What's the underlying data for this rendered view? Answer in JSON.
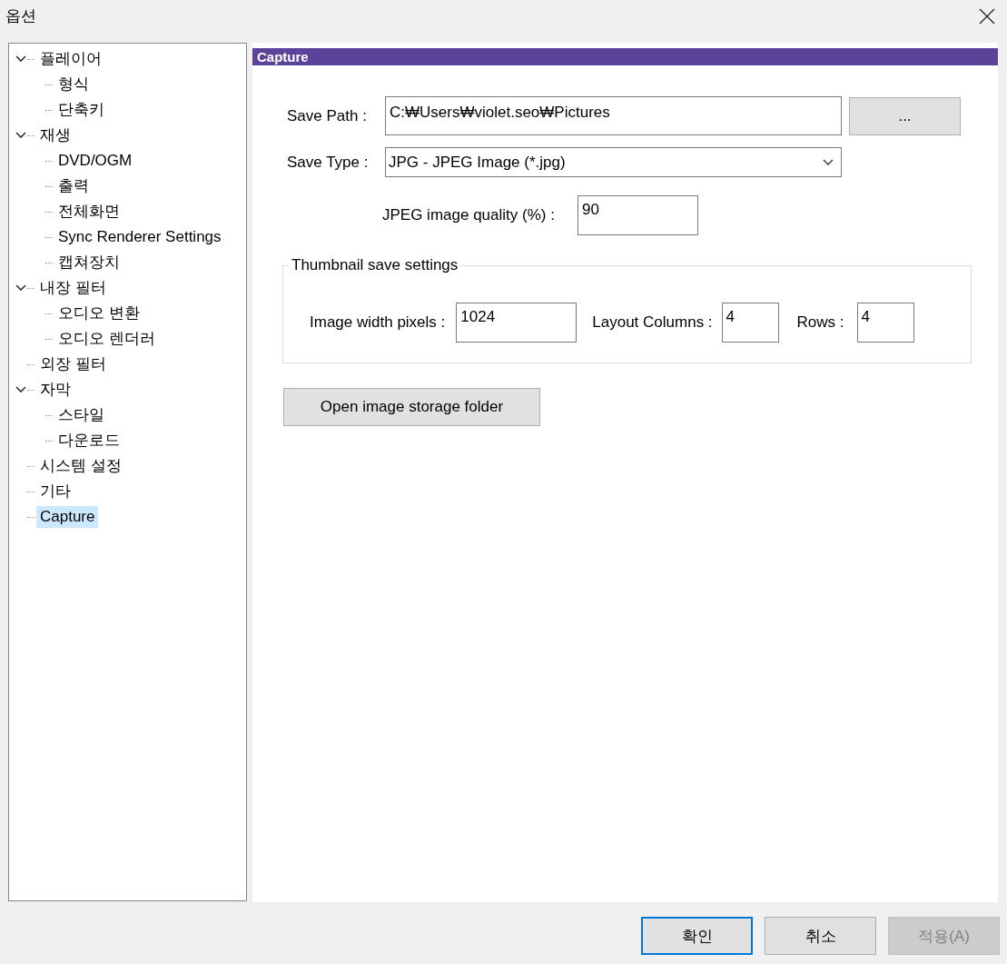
{
  "window": {
    "title": "옵션"
  },
  "tree": [
    {
      "label": "플레이어",
      "expanded": true,
      "selected": false,
      "children": [
        {
          "label": "형식",
          "selected": false
        },
        {
          "label": "단축키",
          "selected": false
        }
      ]
    },
    {
      "label": "재생",
      "expanded": true,
      "selected": false,
      "children": [
        {
          "label": "DVD/OGM",
          "selected": false
        },
        {
          "label": "출력",
          "selected": false
        },
        {
          "label": "전체화면",
          "selected": false
        },
        {
          "label": "Sync Renderer Settings",
          "selected": false
        },
        {
          "label": "캡쳐장치",
          "selected": false
        }
      ]
    },
    {
      "label": "내장 필터",
      "expanded": true,
      "selected": false,
      "children": [
        {
          "label": "오디오 변환",
          "selected": false
        },
        {
          "label": "오디오 렌더러",
          "selected": false
        }
      ]
    },
    {
      "label": "외장 필터",
      "selected": false
    },
    {
      "label": "자막",
      "expanded": true,
      "selected": false,
      "children": [
        {
          "label": "스타일",
          "selected": false
        },
        {
          "label": "다운로드",
          "selected": false
        }
      ]
    },
    {
      "label": "시스템 설정",
      "selected": false
    },
    {
      "label": "기타",
      "selected": false
    },
    {
      "label": "Capture",
      "selected": true
    }
  ],
  "panel": {
    "header": "Capture",
    "save_path": {
      "label": "Save Path :",
      "value": "C:₩Users₩violet.seo₩Pictures"
    },
    "browse_button": "...",
    "save_type": {
      "label": "Save Type :",
      "value": "JPG - JPEG Image (*.jpg)"
    },
    "jpeg_quality": {
      "label": "JPEG image quality (%) :",
      "value": "90"
    },
    "thumbnail": {
      "title": "Thumbnail save settings",
      "fields": [
        {
          "label": "Image width pixels :",
          "value": "1024"
        },
        {
          "label": "Layout Columns :",
          "value": "4"
        },
        {
          "label": "Rows :",
          "value": "4"
        }
      ]
    },
    "open_folder_button": "Open image storage folder"
  },
  "buttons": [
    {
      "label": "확인",
      "default": true,
      "disabled": false
    },
    {
      "label": "취소",
      "default": false,
      "disabled": false
    },
    {
      "label": "적용(A)",
      "default": false,
      "disabled": true
    }
  ]
}
